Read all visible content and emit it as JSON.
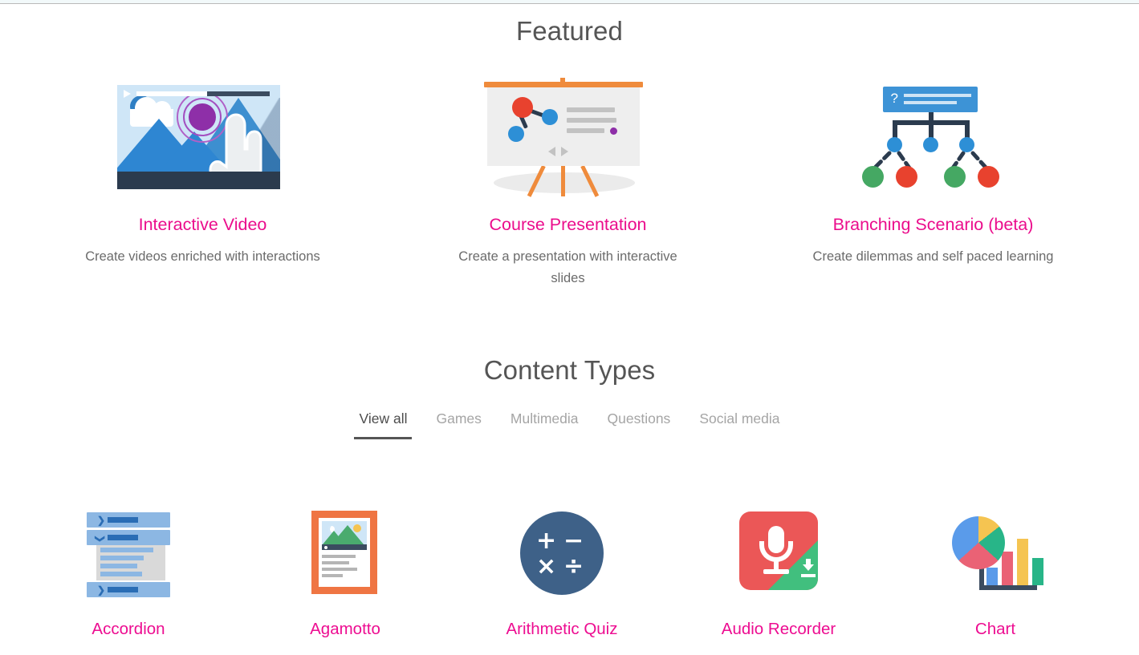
{
  "featured": {
    "heading": "Featured",
    "items": [
      {
        "title": "Interactive Video",
        "description": "Create videos enriched with interactions",
        "icon": "interactive-video-icon"
      },
      {
        "title": "Course Presentation",
        "description": "Create a presentation with interactive slides",
        "icon": "course-presentation-icon"
      },
      {
        "title": "Branching Scenario (beta)",
        "description": "Create dilemmas and self paced learning",
        "icon": "branching-scenario-icon"
      }
    ]
  },
  "content_types": {
    "heading": "Content Types",
    "tabs": [
      {
        "label": "View all",
        "active": true
      },
      {
        "label": "Games",
        "active": false
      },
      {
        "label": "Multimedia",
        "active": false
      },
      {
        "label": "Questions",
        "active": false
      },
      {
        "label": "Social media",
        "active": false
      }
    ],
    "items": [
      {
        "name": "Accordion",
        "icon": "accordion-icon"
      },
      {
        "name": "Agamotto",
        "icon": "agamotto-icon"
      },
      {
        "name": "Arithmetic Quiz",
        "icon": "arithmetic-quiz-icon"
      },
      {
        "name": "Audio Recorder",
        "icon": "audio-recorder-icon"
      },
      {
        "name": "Chart",
        "icon": "chart-icon"
      }
    ]
  },
  "arithmetic_symbols": {
    "plus": "+",
    "minus": "−",
    "times": "×",
    "divide": "÷"
  },
  "branching": {
    "question_mark": "?"
  },
  "accordion_chevrons": {
    "collapsed": "❯",
    "expanded": "❯"
  },
  "colors": {
    "accent_pink": "#ed0d91",
    "heading_gray": "#555555",
    "body_gray": "#6b6b6b",
    "tab_inactive": "#a5a5a5",
    "tab_active": "#4d4d4d"
  }
}
